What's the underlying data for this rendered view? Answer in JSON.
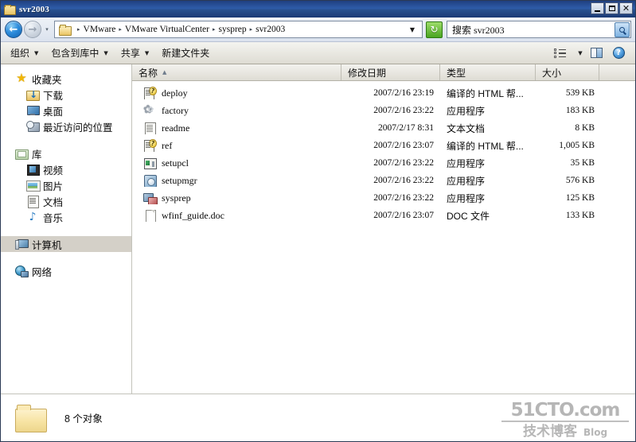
{
  "window": {
    "title": "svr2003",
    "controls": {
      "minimize": "_",
      "maximize": "▫",
      "close": "✕"
    }
  },
  "address_bar": {
    "back_glyph": "←",
    "forward_glyph": "→",
    "recent_glyph": "▾",
    "breadcrumbs": [
      "VMware",
      "VMware VirtualCenter",
      "sysprep",
      "svr2003"
    ],
    "separator": "▸",
    "dropdown_glyph": "▼",
    "refresh_glyph": "↻"
  },
  "search": {
    "value": "搜索 svr2003",
    "placeholder": "搜索 svr2003",
    "icon": "search-icon"
  },
  "toolbar": {
    "items": [
      {
        "label": "组织",
        "has_caret": true
      },
      {
        "label": "包含到库中",
        "has_caret": true
      },
      {
        "label": "共享",
        "has_caret": true
      },
      {
        "label": "新建文件夹",
        "has_caret": false
      }
    ],
    "caret": "▼",
    "right_icons": [
      "views-icon",
      "views-dropdown-caret",
      "preview-pane-icon",
      "help-icon"
    ],
    "help_glyph": "?"
  },
  "sidebar": {
    "groups": [
      {
        "header": {
          "label": "收藏夹",
          "icon": "star-icon"
        },
        "items": [
          {
            "label": "下载",
            "icon": "downloads-folder-icon"
          },
          {
            "label": "桌面",
            "icon": "desktop-monitor-icon"
          },
          {
            "label": "最近访问的位置",
            "icon": "recent-places-icon"
          }
        ]
      },
      {
        "header": {
          "label": "库",
          "icon": "library-folder-icon"
        },
        "items": [
          {
            "label": "视频",
            "icon": "video-icon"
          },
          {
            "label": "图片",
            "icon": "picture-icon"
          },
          {
            "label": "文档",
            "icon": "document-icon"
          },
          {
            "label": "音乐",
            "icon": "music-note-icon"
          }
        ]
      }
    ],
    "computer": {
      "label": "计算机",
      "icon": "computer-icon",
      "selected": true
    },
    "network": {
      "label": "网络",
      "icon": "network-globe-icon"
    }
  },
  "columns": {
    "name": "名称",
    "date": "修改日期",
    "type": "类型",
    "size": "大小",
    "sort_caret": "▲"
  },
  "files": [
    {
      "name": "deploy",
      "date": "2007/2/16 23:19",
      "type": "编译的 HTML 帮...",
      "size": "539 KB",
      "icon": "chm-help-icon"
    },
    {
      "name": "factory",
      "date": "2007/2/16 23:22",
      "type": "应用程序",
      "size": "183 KB",
      "icon": "gears-icon"
    },
    {
      "name": "readme",
      "date": "2007/2/17 8:31",
      "type": "文本文档",
      "size": "8 KB",
      "icon": "text-document-icon"
    },
    {
      "name": "ref",
      "date": "2007/2/16 23:07",
      "type": "编译的 HTML 帮...",
      "size": "1,005 KB",
      "icon": "chm-help-icon"
    },
    {
      "name": "setupcl",
      "date": "2007/2/16 23:22",
      "type": "应用程序",
      "size": "35 KB",
      "icon": "application-icon"
    },
    {
      "name": "setupmgr",
      "date": "2007/2/16 23:22",
      "type": "应用程序",
      "size": "576 KB",
      "icon": "application-wizard-icon"
    },
    {
      "name": "sysprep",
      "date": "2007/2/16 23:22",
      "type": "应用程序",
      "size": "125 KB",
      "icon": "application-sysprep-icon"
    },
    {
      "name": "wfinf_guide.doc",
      "date": "2007/2/16 23:07",
      "type": "DOC 文件",
      "size": "133 KB",
      "icon": "blank-document-icon"
    }
  ],
  "status": {
    "text": "8 个对象",
    "icon": "folder-icon"
  },
  "watermark": {
    "top": "51CTO.com",
    "cn": "技术博客",
    "blog": "Blog"
  }
}
